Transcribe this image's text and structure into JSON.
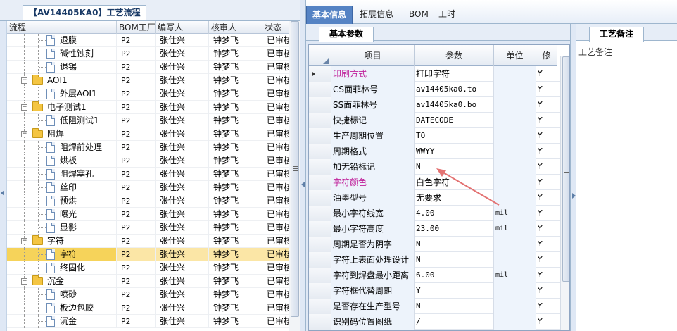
{
  "left_panel": {
    "tab_label": "【AV14405KA0】工艺流程",
    "columns": [
      "流程",
      "BOM工厂",
      "编写人",
      "核审人",
      "状态"
    ],
    "rows": [
      {
        "name": "退膜",
        "bom": "P2",
        "writer": "张仕兴",
        "reviewer": "钟梦飞",
        "status": "已审核",
        "kind": "doc",
        "level": 2
      },
      {
        "name": "碱性蚀刻",
        "bom": "P2",
        "writer": "张仕兴",
        "reviewer": "钟梦飞",
        "status": "已审核",
        "kind": "doc",
        "level": 2
      },
      {
        "name": "退锡",
        "bom": "P2",
        "writer": "张仕兴",
        "reviewer": "钟梦飞",
        "status": "已审核",
        "kind": "doc",
        "level": 2
      },
      {
        "name": "AOI1",
        "bom": "P2",
        "writer": "张仕兴",
        "reviewer": "钟梦飞",
        "status": "已审核",
        "kind": "folder",
        "level": 1
      },
      {
        "name": "外层AOI1",
        "bom": "P2",
        "writer": "张仕兴",
        "reviewer": "钟梦飞",
        "status": "已审核",
        "kind": "doc",
        "level": 2
      },
      {
        "name": "电子测试1",
        "bom": "P2",
        "writer": "张仕兴",
        "reviewer": "钟梦飞",
        "status": "已审核",
        "kind": "folder",
        "level": 1
      },
      {
        "name": "低阻测试1",
        "bom": "P2",
        "writer": "张仕兴",
        "reviewer": "钟梦飞",
        "status": "已审核",
        "kind": "doc",
        "level": 2
      },
      {
        "name": "阻焊",
        "bom": "P2",
        "writer": "张仕兴",
        "reviewer": "钟梦飞",
        "status": "已审核",
        "kind": "folder",
        "level": 1
      },
      {
        "name": "阻焊前处理",
        "bom": "P2",
        "writer": "张仕兴",
        "reviewer": "钟梦飞",
        "status": "已审核",
        "kind": "doc",
        "level": 2
      },
      {
        "name": "烘板",
        "bom": "P2",
        "writer": "张仕兴",
        "reviewer": "钟梦飞",
        "status": "已审核",
        "kind": "doc",
        "level": 2
      },
      {
        "name": "阻焊塞孔",
        "bom": "P2",
        "writer": "张仕兴",
        "reviewer": "钟梦飞",
        "status": "已审核",
        "kind": "doc",
        "level": 2
      },
      {
        "name": "丝印",
        "bom": "P2",
        "writer": "张仕兴",
        "reviewer": "钟梦飞",
        "status": "已审核",
        "kind": "doc",
        "level": 2
      },
      {
        "name": "预烘",
        "bom": "P2",
        "writer": "张仕兴",
        "reviewer": "钟梦飞",
        "status": "已审核",
        "kind": "doc",
        "level": 2
      },
      {
        "name": "曝光",
        "bom": "P2",
        "writer": "张仕兴",
        "reviewer": "钟梦飞",
        "status": "已审核",
        "kind": "doc",
        "level": 2
      },
      {
        "name": "显影",
        "bom": "P2",
        "writer": "张仕兴",
        "reviewer": "钟梦飞",
        "status": "已审核",
        "kind": "doc",
        "level": 2
      },
      {
        "name": "字符",
        "bom": "P2",
        "writer": "张仕兴",
        "reviewer": "钟梦飞",
        "status": "已审核",
        "kind": "folder",
        "level": 1
      },
      {
        "name": "字符",
        "bom": "P2",
        "writer": "张仕兴",
        "reviewer": "钟梦飞",
        "status": "已审核",
        "kind": "doc",
        "level": 2,
        "selected": true
      },
      {
        "name": "终固化",
        "bom": "P2",
        "writer": "张仕兴",
        "reviewer": "钟梦飞",
        "status": "已审核",
        "kind": "doc",
        "level": 2
      },
      {
        "name": "沉金",
        "bom": "P2",
        "writer": "张仕兴",
        "reviewer": "钟梦飞",
        "status": "已审核",
        "kind": "folder",
        "level": 1
      },
      {
        "name": "喷砂",
        "bom": "P2",
        "writer": "张仕兴",
        "reviewer": "钟梦飞",
        "status": "已审核",
        "kind": "doc",
        "level": 2
      },
      {
        "name": "板边包胶",
        "bom": "P2",
        "writer": "张仕兴",
        "reviewer": "钟梦飞",
        "status": "已审核",
        "kind": "doc",
        "level": 2
      },
      {
        "name": "沉金",
        "bom": "P2",
        "writer": "张仕兴",
        "reviewer": "钟梦飞",
        "status": "已审核",
        "kind": "doc",
        "level": 2
      }
    ]
  },
  "top_tabs": [
    {
      "label": "基本信息",
      "active": true
    },
    {
      "label": "拓展信息",
      "active": false
    },
    {
      "label": "BOM",
      "active": false
    },
    {
      "label": "工时",
      "active": false
    }
  ],
  "center_panel": {
    "subtab_label": "基本参数",
    "columns": [
      "项目",
      "参数",
      "单位",
      "修"
    ],
    "rows": [
      {
        "item": "印刷方式",
        "param": "打印字符",
        "unit": "",
        "mod": "Y",
        "pink": true,
        "current": true
      },
      {
        "item": "CS面菲林号",
        "param": "av14405ka0.to",
        "unit": "",
        "mod": "Y"
      },
      {
        "item": "SS面菲林号",
        "param": "av14405ka0.bo",
        "unit": "",
        "mod": "Y"
      },
      {
        "item": "快捷标记",
        "param": "DATECODE",
        "unit": "",
        "mod": "Y"
      },
      {
        "item": "生产周期位置",
        "param": "TO",
        "unit": "",
        "mod": "Y"
      },
      {
        "item": "周期格式",
        "param": "WWYY",
        "unit": "",
        "mod": "Y"
      },
      {
        "item": "加无铅标记",
        "param": "N",
        "unit": "",
        "mod": "Y"
      },
      {
        "item": "字符颜色",
        "param": "白色字符",
        "unit": "",
        "mod": "Y",
        "pink": true
      },
      {
        "item": "油墨型号",
        "param": "无要求",
        "unit": "",
        "mod": "Y"
      },
      {
        "item": "最小字符线宽",
        "param": "4.00",
        "unit": "mil",
        "mod": "Y"
      },
      {
        "item": "最小字符高度",
        "param": "23.00",
        "unit": "mil",
        "mod": "Y"
      },
      {
        "item": "周期是否为阴字",
        "param": "N",
        "unit": "",
        "mod": "Y"
      },
      {
        "item": "字符上表面处理设计",
        "param": "N",
        "unit": "",
        "mod": "Y"
      },
      {
        "item": "字符到焊盘最小距离",
        "param": "6.00",
        "unit": "mil",
        "mod": "Y"
      },
      {
        "item": "字符框代替周期",
        "param": "Y",
        "unit": "",
        "mod": "Y"
      },
      {
        "item": "是否存在生产型号",
        "param": "N",
        "unit": "",
        "mod": "Y"
      },
      {
        "item": "识别码位置图纸",
        "param": "/",
        "unit": "",
        "mod": "Y"
      }
    ]
  },
  "right_panel": {
    "tab_label": "工艺备注",
    "content_label": "工艺备注"
  },
  "colors": {
    "selected_row": "#fbe6a6",
    "active_tab": "#5583c4",
    "pink_text": "#c0219a",
    "annotation_arrow": "#e37272"
  }
}
